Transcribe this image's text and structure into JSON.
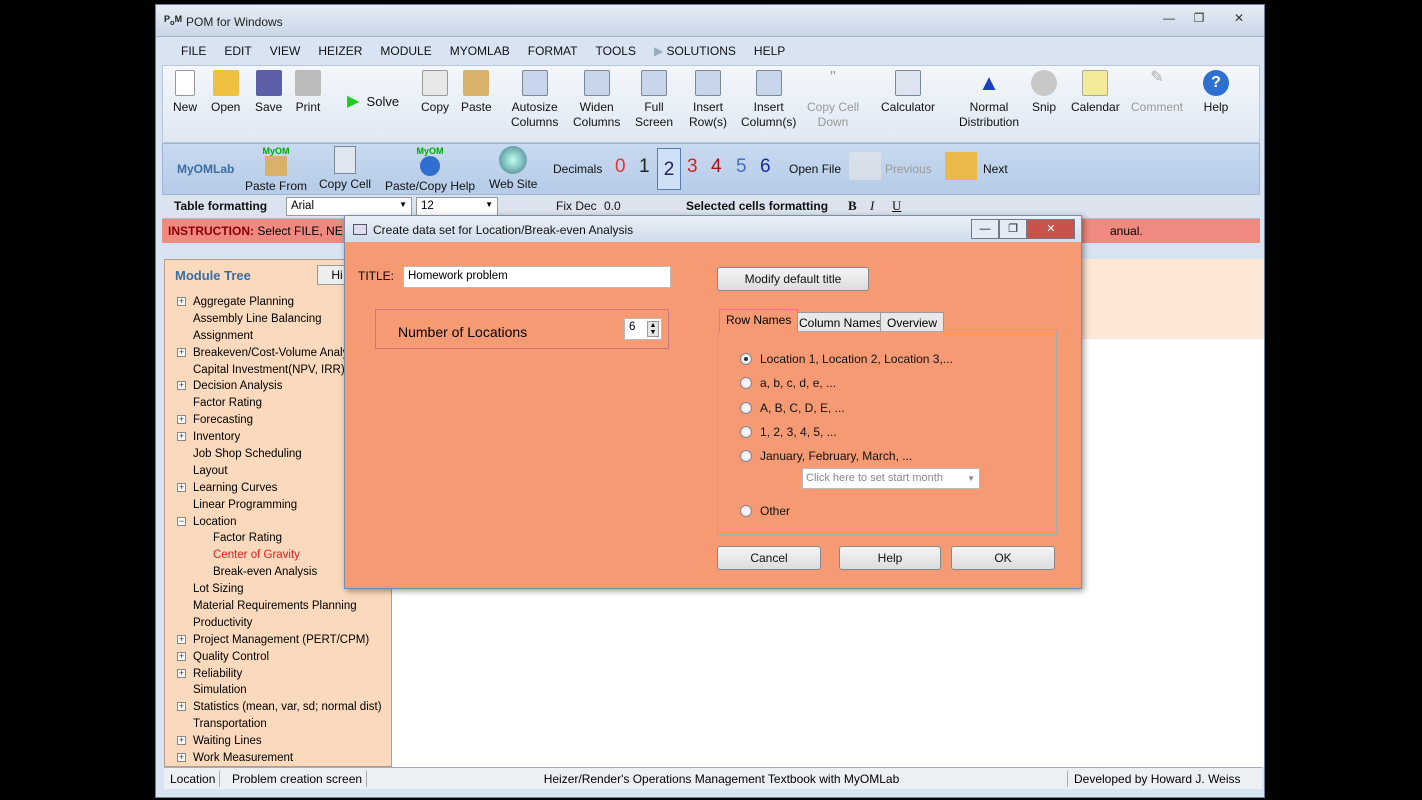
{
  "window": {
    "title": "POM for Windows",
    "min": "—",
    "max": "❐",
    "close": "✕"
  },
  "menu": [
    "FILE",
    "EDIT",
    "VIEW",
    "HEIZER",
    "MODULE",
    "MYOMLAB",
    "FORMAT",
    "TOOLS",
    "SOLUTIONS",
    "HELP"
  ],
  "toolbar": {
    "new": "New",
    "open": "Open",
    "save": "Save",
    "print": "Print",
    "solve": "Solve",
    "copy": "Copy",
    "paste": "Paste",
    "autosize_1": "Autosize",
    "autosize_2": "Columns",
    "widen_1": "Widen",
    "widen_2": "Columns",
    "full_1": "Full",
    "full_2": "Screen",
    "insertrow_1": "Insert",
    "insertrow_2": "Row(s)",
    "insertcol_1": "Insert",
    "insertcol_2": "Column(s)",
    "copydown_1": "Copy Cell",
    "copydown_2": "Down",
    "calculator": "Calculator",
    "normal_1": "Normal",
    "normal_2": "Distribution",
    "snip": "Snip",
    "calendar": "Calendar",
    "comment": "Comment",
    "help": "Help"
  },
  "toolbar2": {
    "myomlab": "MyOMLab",
    "myom_badge": "MyOM",
    "paste_from": "Paste From",
    "copy_cell": "Copy Cell",
    "paste_copy_help": "Paste/Copy Help",
    "web_site": "Web Site",
    "decimals": "Decimals",
    "decimal_values": [
      "0",
      "1",
      "2",
      "3",
      "4",
      "5",
      "6"
    ],
    "open_file": "Open File",
    "previous": "Previous",
    "next": "Next"
  },
  "toolbar3": {
    "table_formatting": "Table formatting",
    "font": "Arial",
    "size": "12",
    "fix_dec": "Fix Dec",
    "fix_val": "0.0",
    "selected": "Selected cells formatting",
    "bold": "B",
    "italic": "I",
    "underline": "U"
  },
  "instruction": {
    "label": "INSTRUCTION:",
    "text": "Select FILE, NE",
    "tail": "anual."
  },
  "module_tree": {
    "title": "Module Tree",
    "hide_btn": "Hi",
    "items": [
      {
        "label": "Aggregate Planning",
        "exp": "+"
      },
      {
        "label": "Assembly Line Balancing",
        "exp": ""
      },
      {
        "label": "Assignment",
        "exp": ""
      },
      {
        "label": "Breakeven/Cost-Volume Analy",
        "exp": "+"
      },
      {
        "label": "Capital Investment(NPV, IRR)",
        "exp": ""
      },
      {
        "label": "Decision Analysis",
        "exp": "+"
      },
      {
        "label": "Factor Rating",
        "exp": ""
      },
      {
        "label": "Forecasting",
        "exp": "+"
      },
      {
        "label": "Inventory",
        "exp": "+"
      },
      {
        "label": "Job Shop Scheduling",
        "exp": ""
      },
      {
        "label": "Layout",
        "exp": ""
      },
      {
        "label": "Learning Curves",
        "exp": "+"
      },
      {
        "label": "Linear Programming",
        "exp": ""
      },
      {
        "label": "Location",
        "exp": "−"
      },
      {
        "label": "Factor Rating",
        "exp": "",
        "child": true
      },
      {
        "label": "Center of Gravity",
        "exp": "",
        "child": true,
        "red": true
      },
      {
        "label": "Break-even Analysis",
        "exp": "",
        "child": true
      },
      {
        "label": "Lot Sizing",
        "exp": ""
      },
      {
        "label": "Material Requirements Planning",
        "exp": ""
      },
      {
        "label": "Productivity",
        "exp": ""
      },
      {
        "label": "Project Management (PERT/CPM)",
        "exp": "+"
      },
      {
        "label": "Quality Control",
        "exp": "+"
      },
      {
        "label": "Reliability",
        "exp": "+"
      },
      {
        "label": "Simulation",
        "exp": ""
      },
      {
        "label": "Statistics (mean, var, sd; normal dist)",
        "exp": "+"
      },
      {
        "label": "Transportation",
        "exp": ""
      },
      {
        "label": "Waiting Lines",
        "exp": "+"
      },
      {
        "label": "Work Measurement",
        "exp": "+"
      }
    ]
  },
  "status": {
    "module": "Location",
    "screen": "Problem creation screen",
    "textbook": "Heizer/Render's Operations Management Textbook with MyOMLab",
    "developer": "Developed by Howard J. Weiss"
  },
  "dialog": {
    "title": "Create data set for Location/Break-even Analysis",
    "title_label": "TITLE:",
    "title_value": "Homework problem",
    "modify_btn": "Modify default title",
    "num_label": "Number of Locations",
    "num_value": "6",
    "tabs": [
      "Row Names",
      "Column Names",
      "Overview"
    ],
    "radios": [
      "Location 1, Location 2, Location 3,...",
      "a, b, c, d, e, ...",
      "A, B, C, D, E, ...",
      "1, 2, 3, 4, 5, ...",
      "January, February, March, ...",
      "Other"
    ],
    "month_placeholder": "Click here to set start month",
    "cancel": "Cancel",
    "help": "Help",
    "ok": "OK"
  }
}
